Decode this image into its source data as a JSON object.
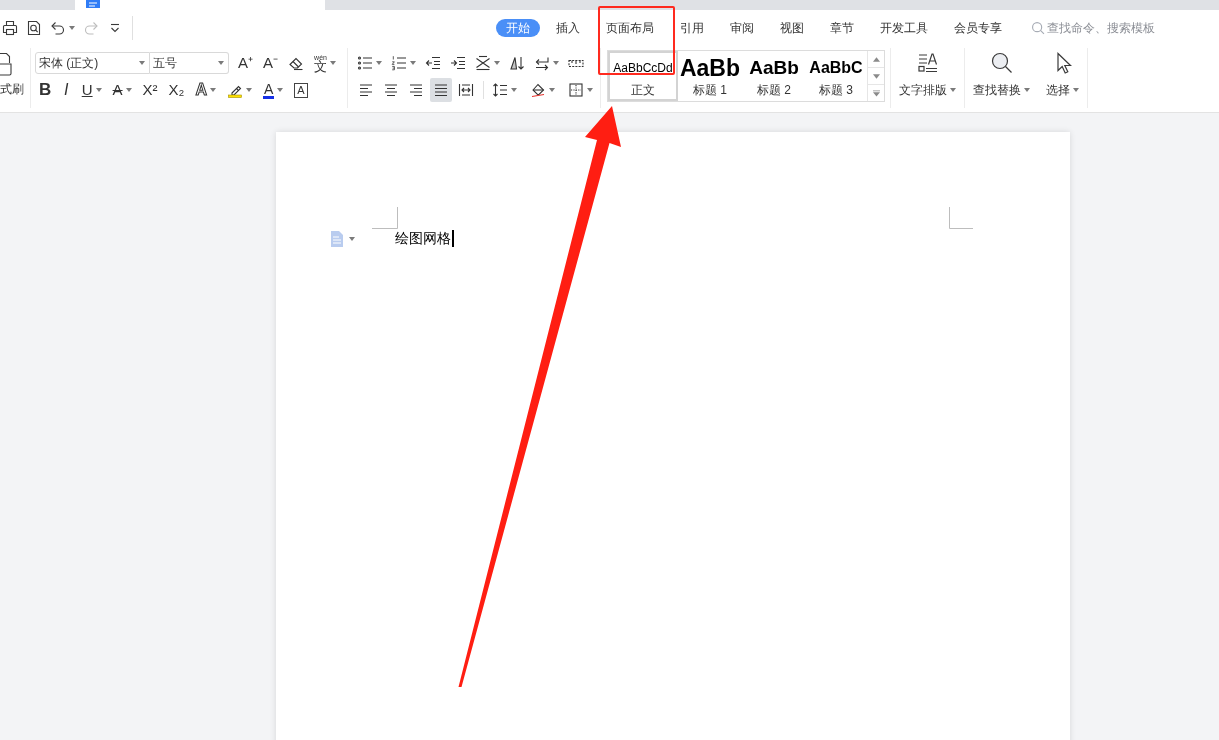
{
  "quick_access": [
    {
      "kind": "print",
      "disabled": false
    },
    {
      "kind": "print-preview",
      "disabled": false
    },
    {
      "kind": "undo",
      "disabled": false,
      "menu": true
    },
    {
      "kind": "redo",
      "disabled": true
    },
    {
      "kind": "customize",
      "disabled": false
    }
  ],
  "menu_tabs": [
    {
      "label": "开始",
      "selected": true,
      "highlighted": false
    },
    {
      "label": "插入",
      "selected": false,
      "highlighted": false
    },
    {
      "label": "页面布局",
      "selected": false,
      "highlighted": true
    },
    {
      "label": "引用",
      "selected": false,
      "highlighted": false
    },
    {
      "label": "审阅",
      "selected": false,
      "highlighted": false
    },
    {
      "label": "视图",
      "selected": false,
      "highlighted": false
    },
    {
      "label": "章节",
      "selected": false,
      "highlighted": false
    },
    {
      "label": "开发工具",
      "selected": false,
      "highlighted": false
    },
    {
      "label": "会员专享",
      "selected": false,
      "highlighted": false
    }
  ],
  "search": {
    "placeholder": "查找命令、搜索模板"
  },
  "ribbon": {
    "format_painter": {
      "label": "式刷"
    },
    "font": {
      "name": "宋体 (正文)",
      "size": "五号",
      "row_1": [
        {
          "kind": "grow",
          "glyph": "A⁺"
        },
        {
          "kind": "shrink",
          "glyph": "A⁻"
        },
        {
          "kind": "clear-format"
        },
        {
          "kind": "pinyin",
          "glyph": "文",
          "ruby": "wén",
          "menu": true
        }
      ],
      "row_2": [
        {
          "kind": "bold",
          "glyph": "B"
        },
        {
          "kind": "italic",
          "glyph": "I"
        },
        {
          "kind": "underline",
          "glyph": "U",
          "menu": true
        },
        {
          "kind": "strikethrough",
          "glyph": "A",
          "menu": true
        },
        {
          "kind": "superscript",
          "glyph": "X²"
        },
        {
          "kind": "subscript",
          "glyph": "X₂"
        },
        {
          "kind": "text-effect",
          "glyph": "A",
          "menu": true
        },
        {
          "kind": "highlight",
          "menu": true
        },
        {
          "kind": "font-color",
          "glyph": "A",
          "menu": true
        },
        {
          "kind": "character-border",
          "glyph": "A"
        }
      ]
    },
    "paragraph": {
      "row_1": [
        {
          "kind": "bullets",
          "menu": true
        },
        {
          "kind": "numbering",
          "menu": true
        },
        {
          "kind": "outdent"
        },
        {
          "kind": "indent"
        },
        {
          "kind": "asian-layout",
          "menu": true
        },
        {
          "kind": "sort"
        },
        {
          "kind": "line-break",
          "menu": true
        },
        {
          "kind": "ruler"
        }
      ],
      "alignment": [
        {
          "kind": "align-left",
          "selected": false
        },
        {
          "kind": "align-center",
          "selected": false
        },
        {
          "kind": "align-right",
          "selected": false
        },
        {
          "kind": "justify",
          "selected": true
        },
        {
          "kind": "distribute",
          "selected": false
        }
      ],
      "row_2": [
        {
          "kind": "line-spacing",
          "menu": true
        },
        {
          "kind": "shading",
          "menu": true
        },
        {
          "kind": "borders",
          "menu": true
        }
      ]
    },
    "styles": [
      {
        "kind": "body",
        "sample": "AaBbCcDd",
        "label": "正文",
        "selected": true
      },
      {
        "kind": "heading-1",
        "sample": "AaBb",
        "label": "标题 1",
        "selected": false
      },
      {
        "kind": "heading-2",
        "sample": "AaBb",
        "label": "标题 2",
        "selected": false
      },
      {
        "kind": "heading-3",
        "sample": "AaBbC",
        "label": "标题 3",
        "selected": false
      }
    ],
    "actions": [
      {
        "kind": "text-layout",
        "label": "文字排版",
        "menu": true
      },
      {
        "kind": "find-replace",
        "label": "查找替换",
        "menu": true
      },
      {
        "kind": "select",
        "label": "选择",
        "menu": true
      }
    ]
  },
  "document": {
    "text": "绘图网格",
    "cursor": true
  },
  "callout_arrow": true
}
